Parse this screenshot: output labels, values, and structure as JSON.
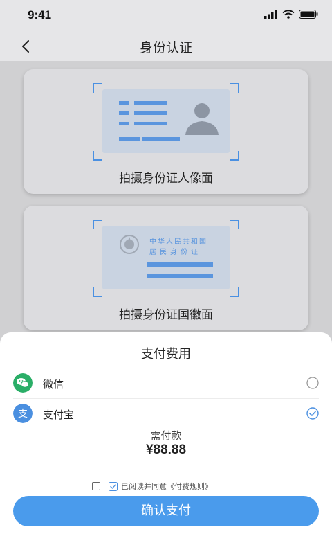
{
  "status_bar": {
    "time": "9:41"
  },
  "nav": {
    "title": "身份认证"
  },
  "cards": {
    "front_label": "拍摄身份证人像面",
    "back_label": "拍摄身份证国徽面",
    "back_text_line1": "中华人民共和国",
    "back_text_line2": "居民身份证"
  },
  "payment": {
    "title": "支付费用",
    "options": [
      {
        "label": "微信",
        "icon": "wechat-icon",
        "selected": false
      },
      {
        "label": "支付宝",
        "icon": "alipay-icon",
        "selected": true
      }
    ],
    "amount_label": "需付款",
    "amount": "¥88.88",
    "agreement_text": "已阅读并同意《付费规则》",
    "confirm_label": "确认支付"
  },
  "colors": {
    "accent": "#4a9bec",
    "wechat": "#2aae67",
    "alipay": "#4a8fe0"
  }
}
